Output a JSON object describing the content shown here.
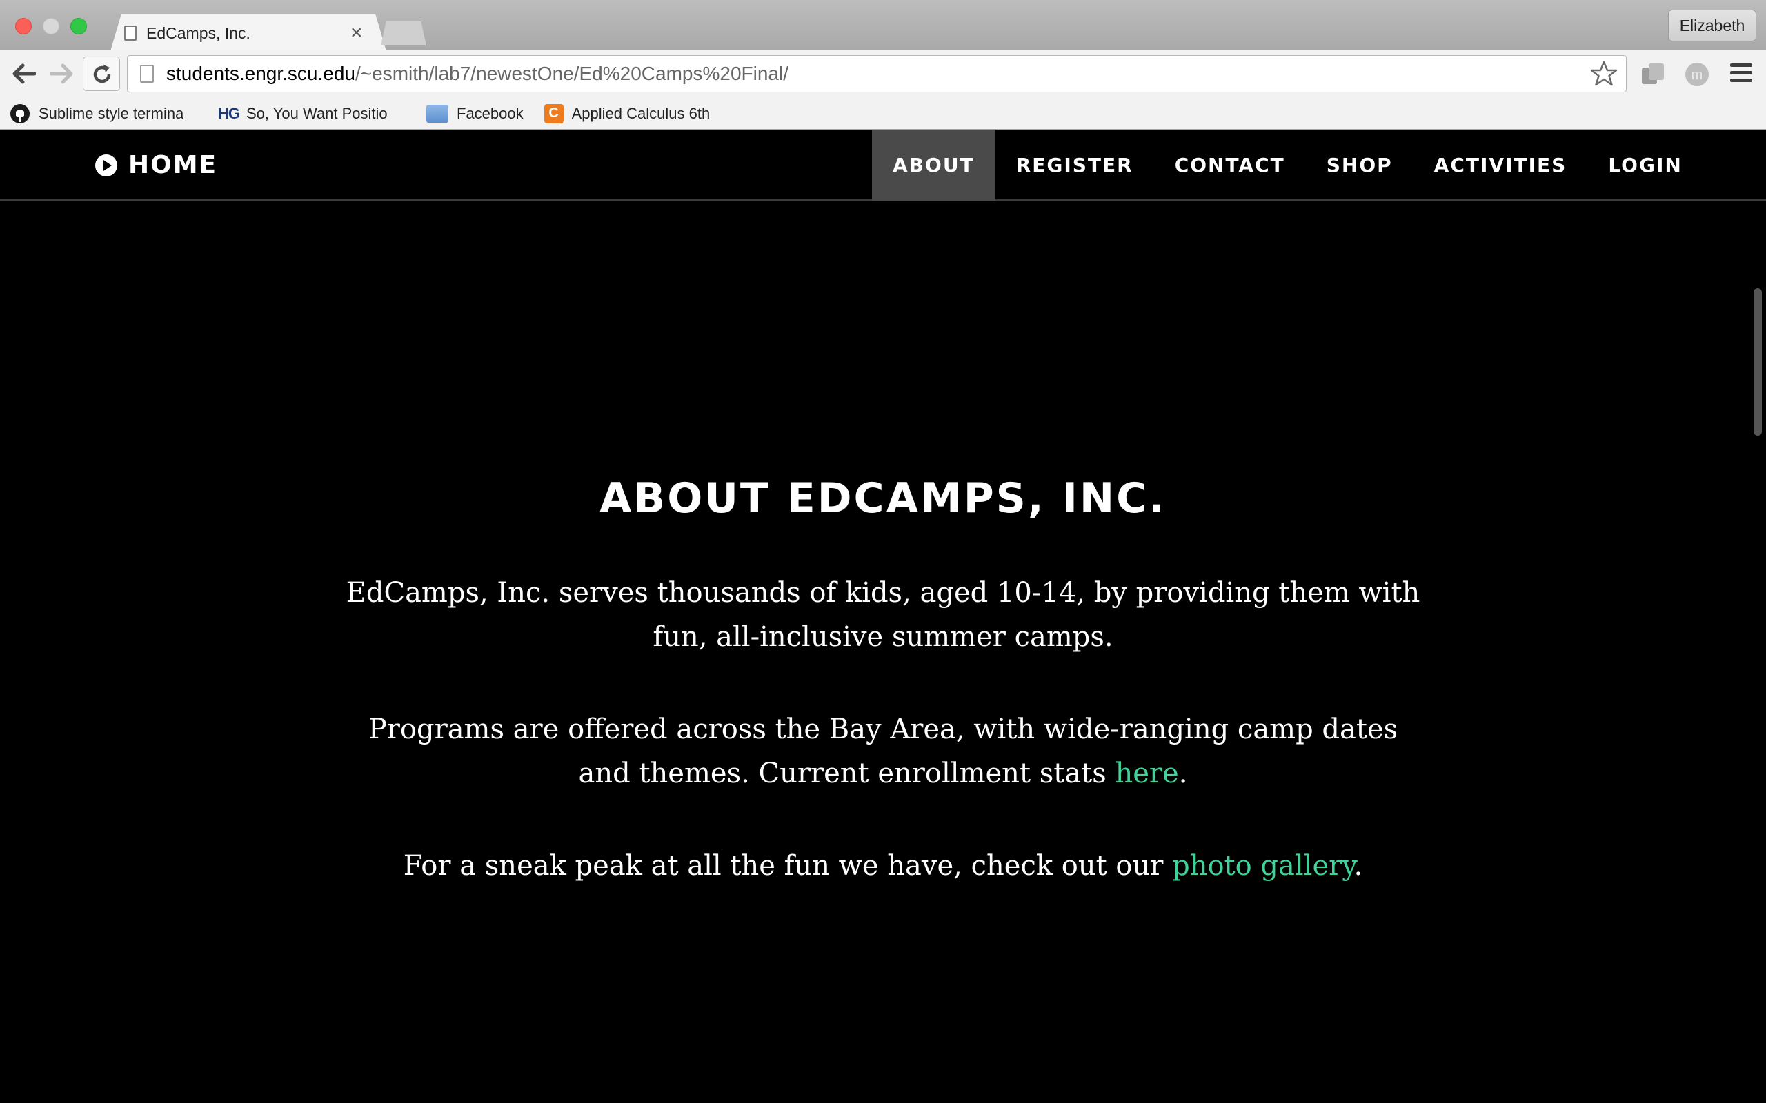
{
  "browser": {
    "tab_title": "EdCamps, Inc.",
    "tab_close": "×",
    "profile_name": "Elizabeth",
    "url_host": "students.engr.scu.edu",
    "url_path": "/~esmith/lab7/newestOne/Ed%20Camps%20Final/",
    "bookmarks": [
      {
        "label": "Sublime style termina",
        "icon": "github-icon"
      },
      {
        "label": "So, You Want Positio",
        "icon": "hg-icon"
      },
      {
        "label": "Facebook",
        "icon": "folder-icon"
      },
      {
        "label": "Applied Calculus 6th",
        "icon": "calc-icon"
      }
    ]
  },
  "site": {
    "brand": "HOME",
    "nav": [
      "ABOUT",
      "REGISTER",
      "CONTACT",
      "SHOP",
      "ACTIVITIES",
      "LOGIN"
    ],
    "active_nav": "ABOUT"
  },
  "about": {
    "heading": "ABOUT EDCAMPS, INC.",
    "p1": "EdCamps, Inc. serves thousands of kids, aged 10-14, by providing them with fun, all-inclusive summer camps.",
    "p2_before": "Programs are offered across the Bay Area, with wide-ranging camp dates and themes. Current enrollment stats ",
    "p2_link": "here",
    "p2_after": ".",
    "p3_before": "For a sneak peak at all the fun we have, check out our ",
    "p3_link": "photo gallery",
    "p3_after": "."
  },
  "colors": {
    "link": "#3fd39a",
    "active_nav_bg": "#4a4a4a",
    "page_bg": "#000000"
  }
}
